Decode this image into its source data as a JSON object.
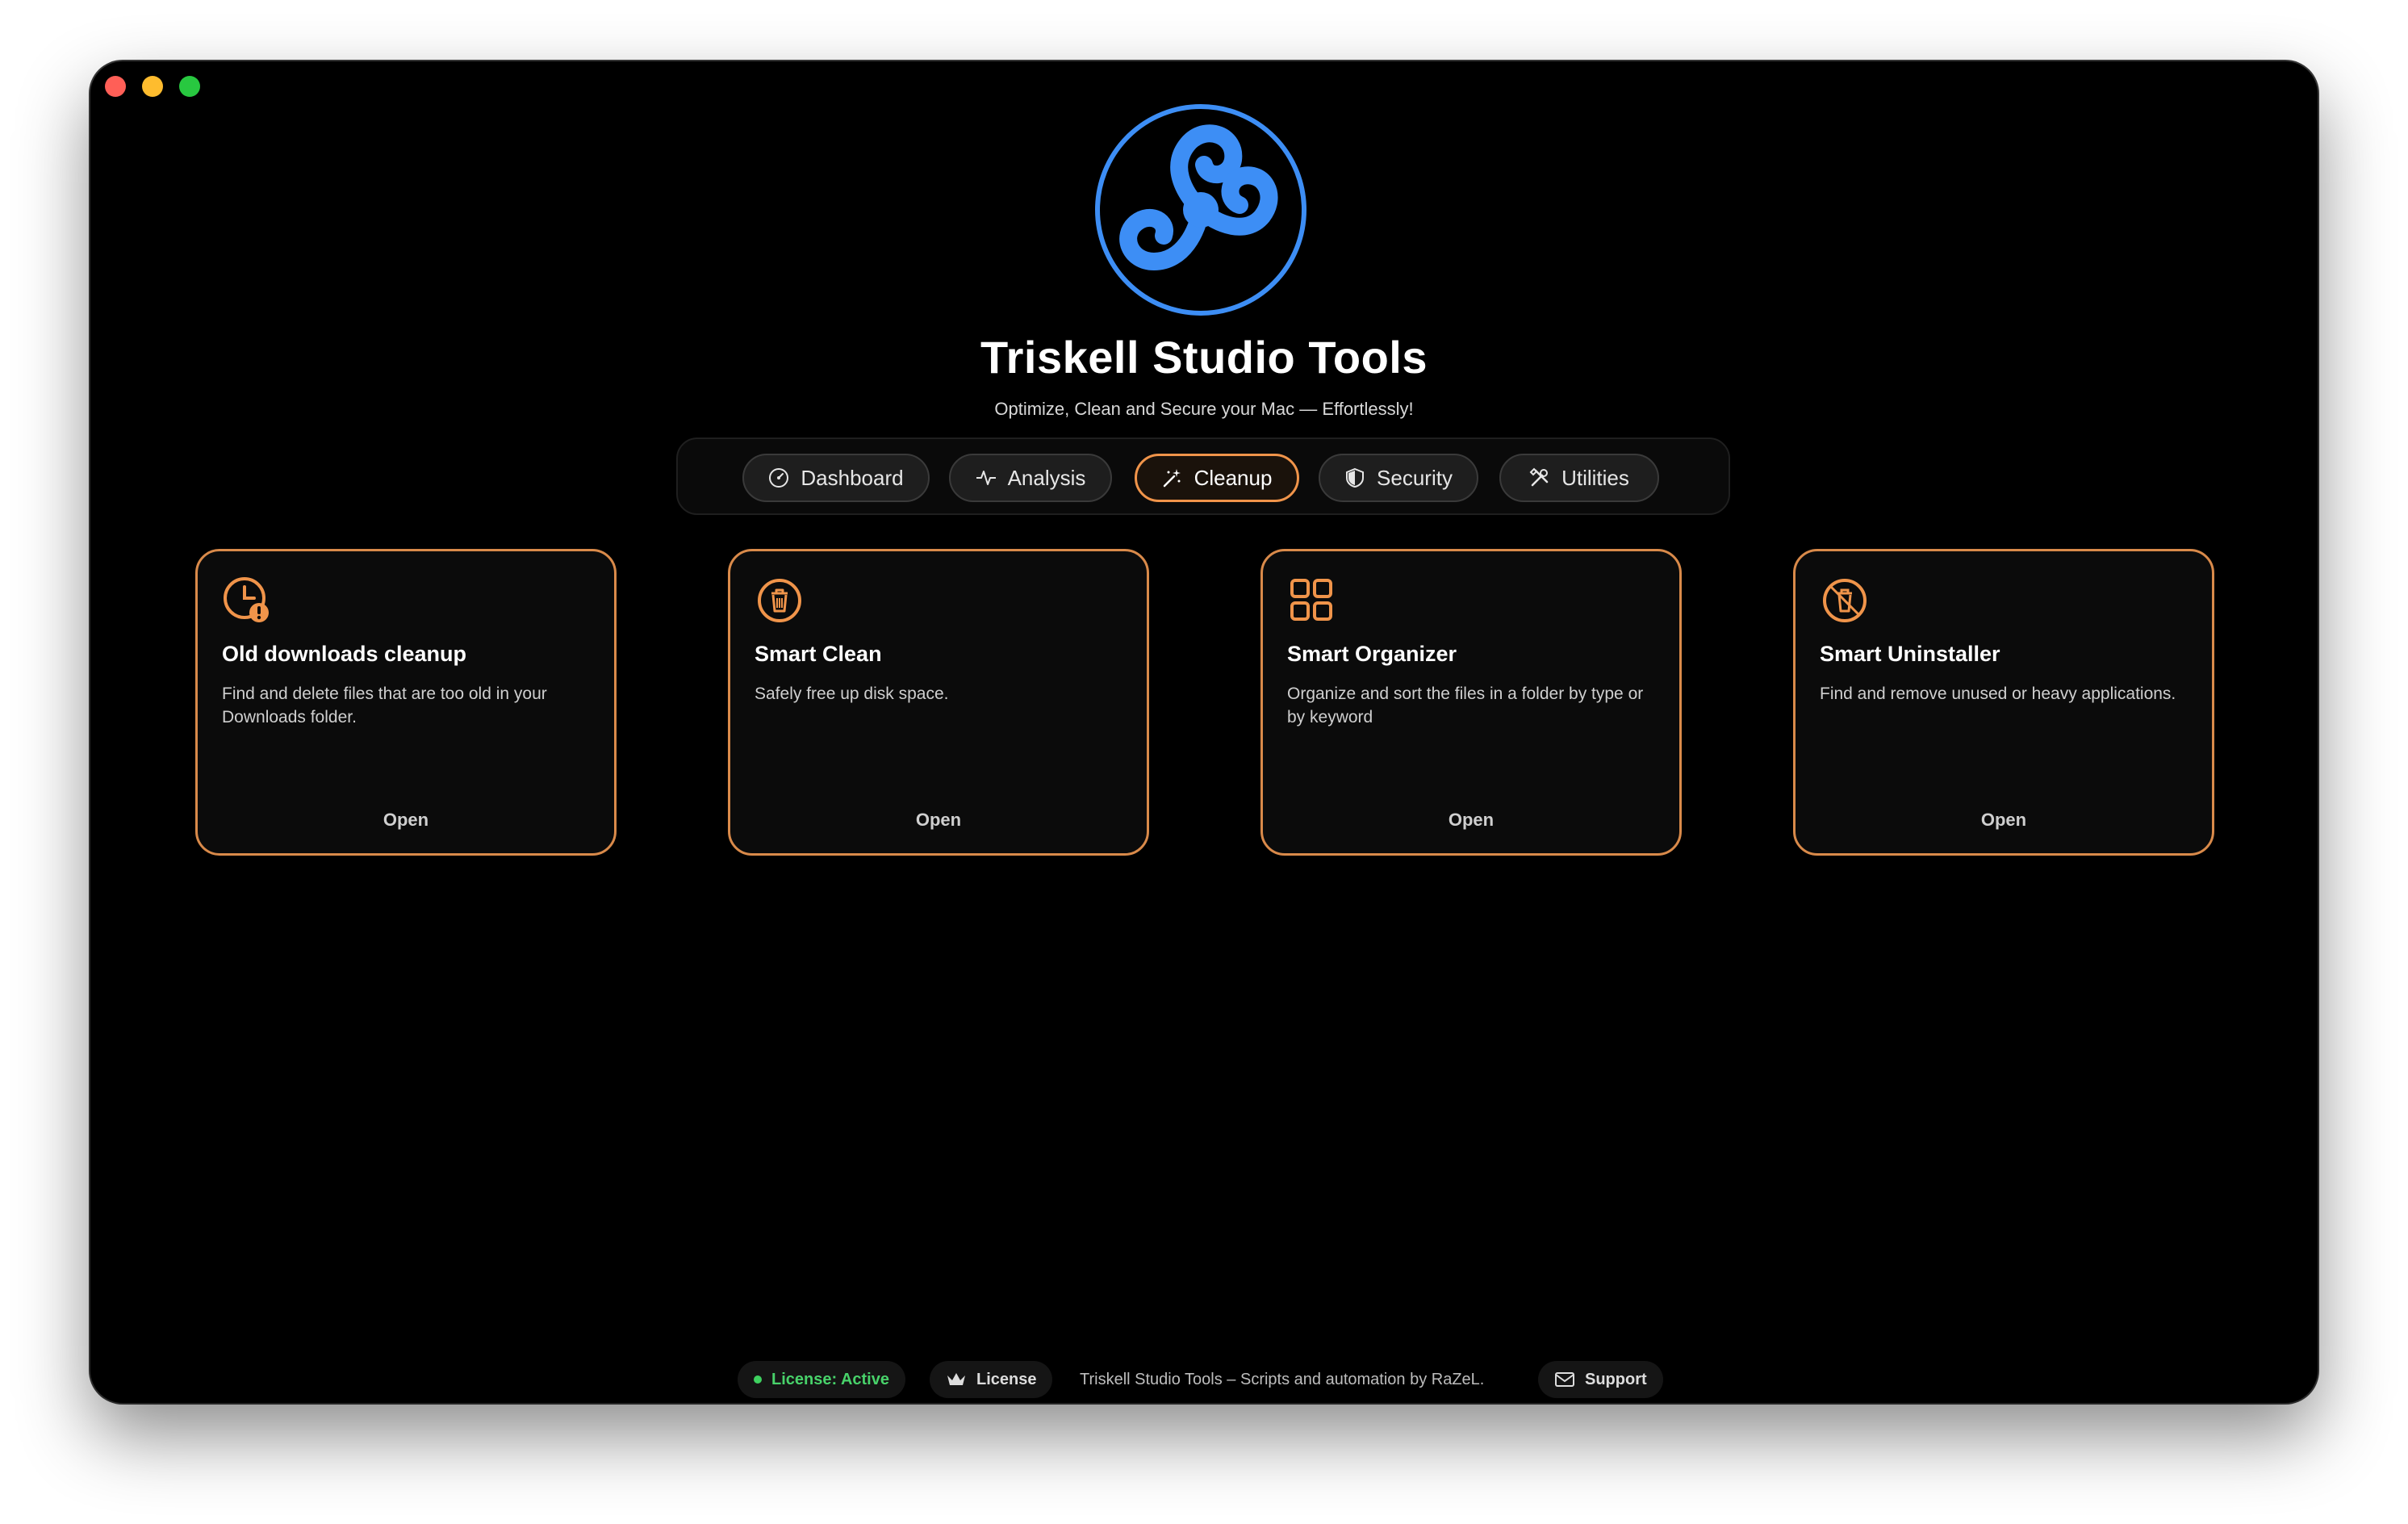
{
  "app": {
    "title": "Triskell Studio Tools",
    "subtitle": "Optimize, Clean and Secure your Mac — Effortlessly!",
    "logo_icon": "triskelion-icon",
    "logo_color": "#3d8ef5"
  },
  "tabs": [
    {
      "label": "Dashboard",
      "icon": "gauge-icon",
      "active": false
    },
    {
      "label": "Analysis",
      "icon": "waveform-icon",
      "active": false
    },
    {
      "label": "Cleanup",
      "icon": "magic-wand-icon",
      "active": true
    },
    {
      "label": "Security",
      "icon": "shield-icon",
      "active": false
    },
    {
      "label": "Utilities",
      "icon": "tools-icon",
      "active": false
    }
  ],
  "cards": [
    {
      "icon": "clock-alert-icon",
      "title": "Old downloads cleanup",
      "description": "Find and delete files that are too old in your Downloads folder.",
      "action": "Open"
    },
    {
      "icon": "trash-icon",
      "title": "Smart Clean",
      "description": "Safely free up disk space.",
      "action": "Open"
    },
    {
      "icon": "grid-icon",
      "title": "Smart Organizer",
      "description": "Organize and sort the files in a folder by type or by keyword",
      "action": "Open"
    },
    {
      "icon": "app-remove-icon",
      "title": "Smart Uninstaller",
      "description": "Find and remove unused or heavy applications.",
      "action": "Open"
    }
  ],
  "footer": {
    "license_status": "License: Active",
    "license_button": "License",
    "credit": "Triskell Studio Tools – Scripts and automation by RaZeL.",
    "support_button": "Support"
  },
  "colors": {
    "accent": "#f0944a",
    "background": "#000000",
    "status_active": "#48d26a"
  }
}
